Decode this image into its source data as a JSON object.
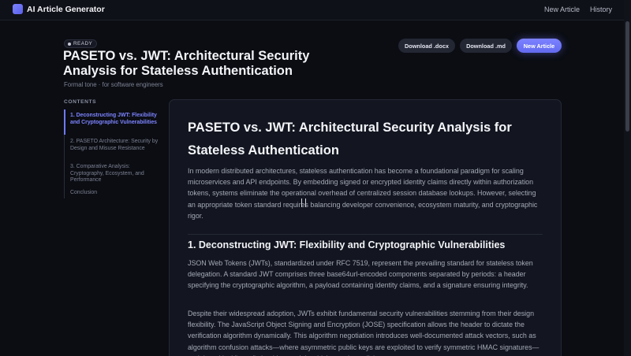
{
  "app": {
    "title": "AI Article Generator",
    "nav": {
      "new_article": "New Article",
      "history": "History"
    }
  },
  "header": {
    "status": "READY",
    "title": "PASETO vs. JWT: Architectural Security Analysis for Stateless Authentication",
    "subtitle": "Formal tone · for software engineers",
    "buttons": {
      "download_docx": "Download .docx",
      "download_md": "Download .md",
      "new_article": "New Article"
    }
  },
  "contents": {
    "label": "CONTENTS",
    "items": [
      {
        "label": "1. Deconstructing JWT: Flexibility and Cryptographic Vulnerabilities",
        "active": true
      },
      {
        "label": "2. PASETO Architecture: Security by Design and Misuse Resistance",
        "active": false
      },
      {
        "label": "3. Comparative Analysis: Cryptography, Ecosystem, and Performance",
        "active": false
      },
      {
        "label": "Conclusion",
        "active": false
      }
    ]
  },
  "article": {
    "title": "PASETO vs. JWT: Architectural Security Analysis for Stateless Authentication",
    "intro": "In modern distributed architectures, stateless authentication has become a foundational paradigm for scaling microservices and API endpoints. By embedding signed or encrypted identity claims directly within authorization tokens, systems eliminate the operational overhead of centralized session database lookups. However, selecting an appropriate token standard requires balancing developer convenience, ecosystem maturity, and cryptographic rigor.",
    "section1": {
      "title": "1. Deconstructing JWT: Flexibility and Cryptographic Vulnerabilities",
      "p1": "JSON Web Tokens (JWTs), standardized under RFC 7519, represent the prevailing standard for stateless token delegation. A standard JWT comprises three base64url-encoded components separated by periods: a header specifying the cryptographic algorithm, a payload containing identity claims, and a signature ensuring integrity.",
      "p2": "Despite their widespread adoption, JWTs exhibit fundamental security vulnerabilities stemming from their design flexibility. The JavaScript Object Signing and Encryption (JOSE) specification allows the header to dictate the verification algorithm dynamically. This algorithm negotiation introduces well-documented attack vectors, such as algorithm confusion attacks—where asymmetric public keys are exploited to verify symmetric HMAC signatures—and the critical \"none\" algorithm exploit, which permits malicious actors to"
    }
  }
}
